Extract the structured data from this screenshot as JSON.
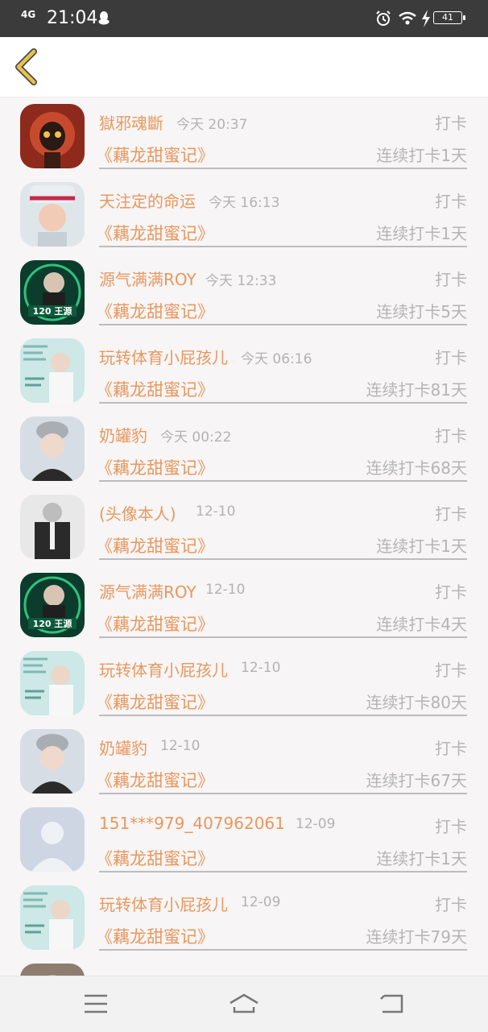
{
  "status_bar": {
    "network": "4G",
    "time": "21:04",
    "battery": "41"
  },
  "colors": {
    "accent_orange": "#e8985f",
    "back_arrow_yellow": "#e7c24a",
    "muted_gray": "#b5b5b5"
  },
  "entries": [
    {
      "name": "獄邪魂斷",
      "time": "今天 20:37",
      "action": "打卡",
      "book": "《藕龙甜蜜记》",
      "streak": "连续打卡1天",
      "avatar": "avatar-red-mask"
    },
    {
      "name": "天注定的命运",
      "time": "今天 16:13",
      "action": "打卡",
      "book": "《藕龙甜蜜记》",
      "streak": "连续打卡1天",
      "avatar": "avatar-headdress"
    },
    {
      "name": "源气满满ROY",
      "time": "今天 12:33",
      "action": "打卡",
      "book": "《藕龙甜蜜记》",
      "streak": "连续打卡5天",
      "avatar": "avatar-green-poster"
    },
    {
      "name": "玩转体育小屁孩儿",
      "time": "今天 06:16",
      "action": "打卡",
      "book": "《藕龙甜蜜记》",
      "streak": "连续打卡81天",
      "avatar": "avatar-teal-poster"
    },
    {
      "name": "奶罐豹",
      "time": "今天 00:22",
      "action": "打卡",
      "book": "《藕龙甜蜜记》",
      "streak": "连续打卡68天",
      "avatar": "avatar-beanie"
    },
    {
      "name": "(头像本人)",
      "time": "12-10",
      "action": "打卡",
      "book": "《藕龙甜蜜记》",
      "streak": "连续打卡1天",
      "avatar": "avatar-bw-suit"
    },
    {
      "name": "源气满满ROY",
      "time": "12-10",
      "action": "打卡",
      "book": "《藕龙甜蜜记》",
      "streak": "连续打卡4天",
      "avatar": "avatar-green-poster"
    },
    {
      "name": "玩转体育小屁孩儿",
      "time": "12-10",
      "action": "打卡",
      "book": "《藕龙甜蜜记》",
      "streak": "连续打卡80天",
      "avatar": "avatar-teal-poster"
    },
    {
      "name": "奶罐豹",
      "time": "12-10",
      "action": "打卡",
      "book": "《藕龙甜蜜记》",
      "streak": "连续打卡67天",
      "avatar": "avatar-beanie"
    },
    {
      "name": "151***979_407962061",
      "time": "12-09",
      "action": "打卡",
      "book": "《藕龙甜蜜记》",
      "streak": "连续打卡1天",
      "avatar": "avatar-default"
    },
    {
      "name": "玩转体育小屁孩儿",
      "time": "12-09",
      "action": "打卡",
      "book": "《藕龙甜蜜记》",
      "streak": "连续打卡79天",
      "avatar": "avatar-teal-poster"
    },
    {
      "name": "",
      "time": "",
      "action": "",
      "book": "",
      "streak": "",
      "avatar": "avatar-partial"
    }
  ],
  "icons": {
    "back": "chevron-left-icon",
    "menu": "menu-icon",
    "home": "home-icon",
    "return": "return-icon"
  }
}
